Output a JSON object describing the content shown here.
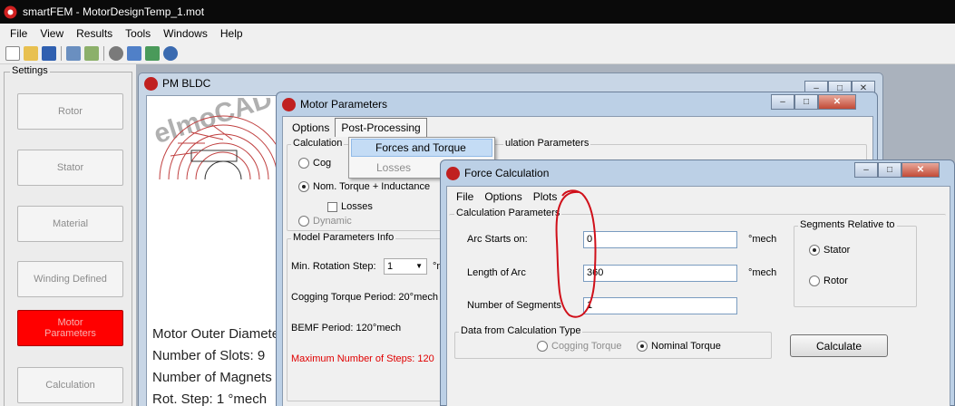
{
  "app": {
    "title": "smartFEM  - MotorDesignTemp_1.mot",
    "menu": [
      "File",
      "View",
      "Results",
      "Tools",
      "Windows",
      "Help"
    ]
  },
  "settings": {
    "title": "Settings",
    "buttons": [
      "Rotor",
      "Stator",
      "Material",
      "Winding Defined",
      "Motor Parameters",
      "Calculation"
    ]
  },
  "pm_window": {
    "title": "PM BLDC",
    "logo_text": "elmoCAD",
    "info": [
      "Motor Outer Diamete",
      "Number of Slots: 9",
      "Number of Magnets",
      "Rot. Step: 1 °mech"
    ]
  },
  "motor_params": {
    "title": "Motor Parameters",
    "menu": {
      "options": "Options",
      "post": "Post-Processing"
    },
    "dropdown": {
      "forces": "Forces and Torque",
      "losses": "Losses"
    },
    "calc_group_title": "Calculation",
    "calc_params_title": "ulation Parameters",
    "radio_cog": "Cog",
    "radio_nom": "Nom. Torque + Inductance",
    "check_losses": "Losses",
    "radio_dynamic": "Dynamic",
    "model_group_title": "Model Parameters Info",
    "min_rot_label": "Min. Rotation Step:",
    "min_rot_value": "1",
    "min_rot_unit": "°m",
    "cogging_period": "Cogging Torque Period: 20°mech",
    "bemf_period": "BEMF Period: 120°mech",
    "max_steps": "Maximum Number of Steps: 120"
  },
  "force_calc": {
    "title": "Force Calculation",
    "menu": [
      "File",
      "Options",
      "Plots"
    ],
    "calc_params_title": "Calculation Parameters",
    "arc_start_label": "Arc Starts on:",
    "arc_start_value": "0",
    "arc_len_label": "Length of Arc",
    "arc_len_value": "360",
    "segments_label": "Number of Segments",
    "segments_value": "1",
    "unit": "°mech",
    "segments_rel_title": "Segments Relative to",
    "stator": "Stator",
    "rotor": "Rotor",
    "data_from_title": "Data from Calculation Type",
    "cogging": "Cogging Torque",
    "nominal": "Nominal Torque",
    "calculate": "Calculate"
  },
  "colors": {
    "accent_red": "#ff0000",
    "annotation": "#d0101a"
  }
}
